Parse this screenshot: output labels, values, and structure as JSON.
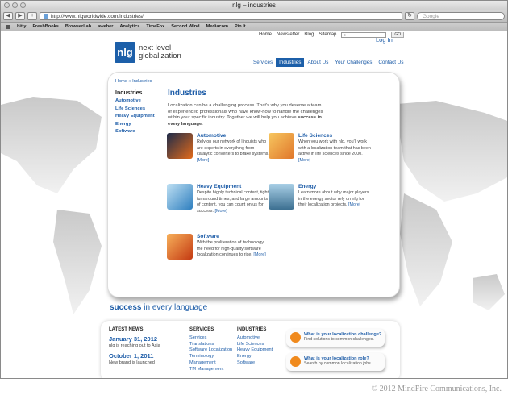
{
  "browser": {
    "window_title": "nlg – industries",
    "url": "http://www.nlgworldwide.com/industries/",
    "search_placeholder": "Google",
    "go_label": "GO",
    "bookmarks": [
      "bitly",
      "FreshBooks",
      "BrowserLab",
      "aweber",
      "Analytics",
      "TimeFox",
      "Second Wind",
      "Mediacom",
      "Pin It"
    ]
  },
  "site": {
    "top_links": [
      "Home",
      "Newsletter",
      "Blog",
      "Sitemap"
    ],
    "login": "Log In",
    "logo_mark": "nlg",
    "logo_line1": "next level",
    "logo_line2": "globalization",
    "main_nav": [
      {
        "label": "Services",
        "active": false
      },
      {
        "label": "Industries",
        "active": true
      },
      {
        "label": "About Us",
        "active": false
      },
      {
        "label": "Your Challenges",
        "active": false
      },
      {
        "label": "Contact Us",
        "active": false
      }
    ]
  },
  "main": {
    "breadcrumb": "Home » Industries",
    "side_title": "Industries",
    "side_items": [
      "Automotive",
      "Life Sciences",
      "Heavy Equipment",
      "Energy",
      "Software"
    ],
    "title": "Industries",
    "intro_part1": "Localization can be a challenging process. That's why you deserve a team of experienced professionals who have know-how to handle the challenges within your specific industry. Together we will help you achieve ",
    "intro_bold": "success in every language",
    "intro_end": ".",
    "more_label": "[More]",
    "industries": [
      {
        "title": "Automotive",
        "text": "Rely on our network of linguists who are experts in everything from catalytic converters to brake systems.",
        "color": "#e26a1a"
      },
      {
        "title": "Life Sciences",
        "text": "When you work with nlg, you'll work with a localization team that has been active in life sciences since 2000.",
        "color": "#f3a13a"
      },
      {
        "title": "Heavy Equipment",
        "text": "Despite highly technical content, tight turnaround times, and large amounts of content, you can count on us for success.",
        "color": "#4aa0d8"
      },
      {
        "title": "Energy",
        "text": "Learn more about why major players in the energy sector rely on nlg for their localization projects.",
        "color": "#8ab8d8"
      },
      {
        "title": "Software",
        "text": "With the proliferation of technology, the need for high-quality software localization continues to rise.",
        "color": "#f07a1a"
      }
    ]
  },
  "tagline_bold": "success",
  "tagline_rest": " in every language",
  "footer": {
    "news_title": "LATEST NEWS",
    "news": [
      {
        "date": "January 31, 2012",
        "text": "nlg is reaching out to Asia"
      },
      {
        "date": "October 1, 2011",
        "text": "New brand is launched"
      }
    ],
    "services_title": "SERVICES",
    "services": [
      "Services",
      "Translations",
      "Software Localization",
      "Terminology",
      "Management",
      "TM Management"
    ],
    "industries_title": "INDUSTRIES",
    "industries": [
      "Automotive",
      "Life Sciences",
      "Heavy Equipment",
      "Energy",
      "Software"
    ],
    "promos": [
      {
        "title": "What is your localization challenge?",
        "sub": "Find solutions to common challenges."
      },
      {
        "title": "What is your localization role?",
        "sub": "Search by common localization jobs."
      }
    ]
  },
  "copyright": "© 2012 MindFire Communications, Inc."
}
